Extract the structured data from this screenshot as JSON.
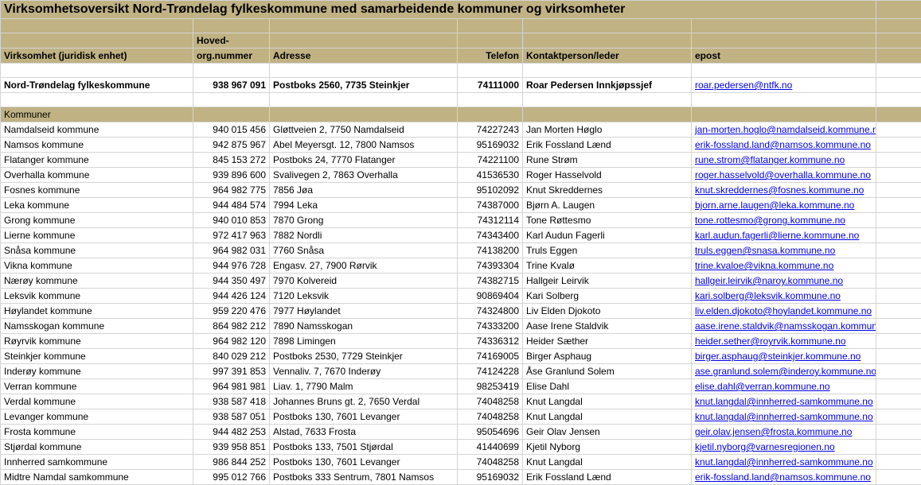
{
  "title": "Virksomhetsoversikt Nord-Trøndelag fylkeskommune med samarbeidende kommuner og virksomheter",
  "headers": {
    "virksomhet": "Virksomhet (juridisk enhet)",
    "hoved_org_line1": "Hoved-",
    "hoved_org_line2": "org.nummer",
    "adresse": "Adresse",
    "telefon": "Telefon",
    "kontakt": "Kontaktperson/leder",
    "epost": "epost"
  },
  "main_row": {
    "name": "Nord-Trøndelag fylkeskommune",
    "org": "938 967 091",
    "adresse": "Postboks 2560, 7735 Steinkjer",
    "telefon": "74111000",
    "kontakt": "Roar Pedersen Innkjøpssjef",
    "epost": "roar.pedersen@ntfk.no"
  },
  "section_kommuner": "Kommuner",
  "rows": [
    {
      "name": "Namdalseid kommune",
      "org": "940 015 456",
      "adresse": "Gløttveien 2, 7750 Namdalseid",
      "telefon": "74227243",
      "kontakt": "Jan Morten Høglo",
      "epost": "jan-morten.hoglo@namdalseid.kommune.no"
    },
    {
      "name": "Namsos kommune",
      "org": "942 875 967",
      "adresse": "Abel Meyersgt. 12, 7800 Namsos",
      "telefon": "95169032",
      "kontakt": "Erik Fossland Lænd",
      "epost": "erik-fossland.land@namsos.kommune.no"
    },
    {
      "name": "Flatanger kommune",
      "org": "845 153 272",
      "adresse": "Postboks 24, 7770 Flatanger",
      "telefon": "74221100",
      "kontakt": "Rune Strøm",
      "epost": "rune.strom@flatanger.kommune.no"
    },
    {
      "name": "Overhalla kommune",
      "org": "939 896 600",
      "adresse": "Svalivegen 2, 7863 Overhalla",
      "telefon": "41536530",
      "kontakt": "Roger Hasselvold",
      "epost": "roger.hasselvold@overhalla.kommune.no"
    },
    {
      "name": "Fosnes kommune",
      "org": "964 982 775",
      "adresse": "7856 Jøa",
      "telefon": "95102092",
      "kontakt": "Knut Skreddernes",
      "epost": "knut.skreddernes@fosnes.kommune.no"
    },
    {
      "name": "Leka kommune",
      "org": "944 484 574",
      "adresse": "7994 Leka",
      "telefon": "74387000",
      "kontakt": "Bjørn A. Laugen",
      "epost": "bjorn.arne.laugen@leka.kommune.no"
    },
    {
      "name": "Grong kommune",
      "org": "940 010 853",
      "adresse": "7870 Grong",
      "telefon": "74312114",
      "kontakt": "Tone Røttesmo",
      "epost": "tone.rottesmo@grong.kommune.no"
    },
    {
      "name": "Lierne kommune",
      "org": "972 417 963",
      "adresse": "7882 Nordli",
      "telefon": "74343400",
      "kontakt": "Karl Audun Fagerli",
      "epost": "karl.audun.fagerli@lierne.kommune.no"
    },
    {
      "name": "Snåsa kommune",
      "org": "964 982 031",
      "adresse": "7760 Snåsa",
      "telefon": "74138200",
      "kontakt": "Truls Eggen",
      "epost": "truls.eggen@snasa.kommune.no"
    },
    {
      "name": "Vikna kommune",
      "org": "944 976 728",
      "adresse": "Engasv. 27, 7900 Rørvik",
      "telefon": "74393304",
      "kontakt": "Trine Kvalø",
      "epost": "trine.kvaloe@vikna.kommune.no"
    },
    {
      "name": "Nærøy kommune",
      "org": "944 350 497",
      "adresse": "7970 Kolvereid",
      "telefon": "74382715",
      "kontakt": "Hallgeir Leirvik",
      "epost": "hallgeir.leirvik@naroy.kommune.no"
    },
    {
      "name": "Leksvik kommune",
      "org": "944 426 124",
      "adresse": "7120 Leksvik",
      "telefon": "90869404",
      "kontakt": "Kari Solberg",
      "epost": "kari.solberg@leksvik.kommune.no"
    },
    {
      "name": "Høylandet kommune",
      "org": "959 220 476",
      "adresse": "7977 Høylandet",
      "telefon": "74324800",
      "kontakt": "Liv Elden Djokoto",
      "epost": "liv.elden.djokoto@hoylandet.kommune.no"
    },
    {
      "name": "Namsskogan kommune",
      "org": "864 982 212",
      "adresse": "7890 Namsskogan",
      "telefon": "74333200",
      "kontakt": "Aase Irene Staldvik",
      "epost": "aase.irene.staldvik@namsskogan.kommune.no"
    },
    {
      "name": "Røyrvik kommune",
      "org": "964 982 120",
      "adresse": "7898 Limingen",
      "telefon": "74336312",
      "kontakt": "Heider Sæther",
      "epost": "heider.sether@royrvik.kommune.no"
    },
    {
      "name": "Steinkjer kommune",
      "org": "840 029 212",
      "adresse": "Postboks 2530, 7729 Steinkjer",
      "telefon": "74169005",
      "kontakt": "Birger Asphaug",
      "epost": "birger.asphaug@steinkjer.kommune.no"
    },
    {
      "name": "Inderøy kommune",
      "org": "997 391 853",
      "adresse": "Vennaliv. 7, 7670 Inderøy",
      "telefon": "74124228",
      "kontakt": "Åse Granlund Solem",
      "epost": "ase.granlund.solem@inderoy.kommune.no"
    },
    {
      "name": "Verran kommune",
      "org": "964 981 981",
      "adresse": "Liav. 1, 7790 Malm",
      "telefon": "98253419",
      "kontakt": "Elise Dahl",
      "epost": "elise.dahl@verran.kommune.no"
    },
    {
      "name": "Verdal kommune",
      "org": "938 587 418",
      "adresse": "Johannes Bruns gt. 2, 7650 Verdal",
      "telefon": "74048258",
      "kontakt": "Knut Langdal",
      "epost": "knut.langdal@innherred-samkommune.no"
    },
    {
      "name": "Levanger kommune",
      "org": "938 587 051",
      "adresse": "Postboks 130, 7601 Levanger",
      "telefon": "74048258",
      "kontakt": "Knut Langdal",
      "epost": "knut.langdal@innherred-samkommune.no"
    },
    {
      "name": "Frosta kommune",
      "org": "944 482 253",
      "adresse": "Alstad, 7633 Frosta",
      "telefon": "95054696",
      "kontakt": "Geir Olav Jensen",
      "epost": "geir.olav.jensen@frosta.kommune.no"
    },
    {
      "name": "Stjørdal kommune",
      "org": "939 958 851",
      "adresse": "Postboks 133, 7501 Stjørdal",
      "telefon": "41440699",
      "kontakt": "Kjetil Nyborg",
      "epost": "kjetil.nyborg@varnesregionen.no"
    },
    {
      "name": "Innherred samkommune",
      "org": "986 844 252",
      "adresse": "Postboks 130, 7601 Levanger",
      "telefon": "74048258",
      "kontakt": "Knut Langdal",
      "epost": "knut.langdal@innherred-samkommune.no"
    },
    {
      "name": "Midtre Namdal samkommune",
      "org": "995 012 766",
      "adresse": "Postboks 333 Sentrum, 7801 Namsos",
      "telefon": "95169032",
      "kontakt": "Erik Fossland Lænd",
      "epost": "erik-fossland.land@namsos.kommune.no"
    }
  ]
}
